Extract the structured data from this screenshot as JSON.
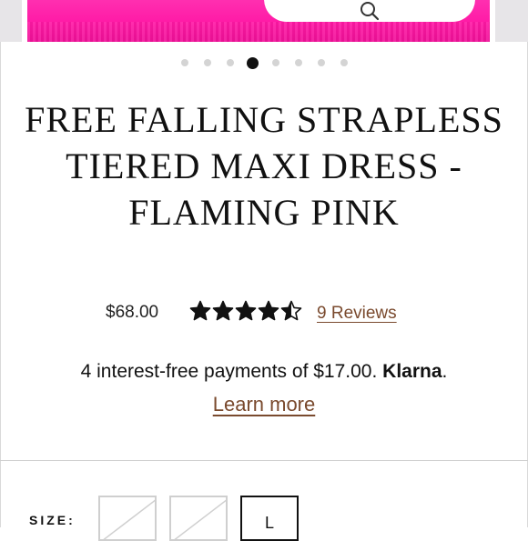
{
  "product": {
    "title": "FREE FALLING STRAPLESS TIERED MAXI DRESS - FLAMING PINK",
    "price": "$68.00",
    "rating": 4.5,
    "rating_max": 5,
    "reviews_label": "9 Reviews"
  },
  "carousel": {
    "slide_count": 8,
    "active_index": 3,
    "zoom_icon": "search-icon",
    "image_color": "#ff1aa6"
  },
  "payment": {
    "installment_text": "4 interest-free payments of $17.00.",
    "provider": "Klarna",
    "period": ".",
    "learn_more": "Learn more"
  },
  "size": {
    "label": "SIZE:",
    "options": [
      {
        "label": "",
        "available": false
      },
      {
        "label": "",
        "available": false
      },
      {
        "label": "L",
        "available": true,
        "selected": true
      }
    ]
  },
  "colors": {
    "accent_link": "#7a4a2e",
    "text": "#111111"
  }
}
